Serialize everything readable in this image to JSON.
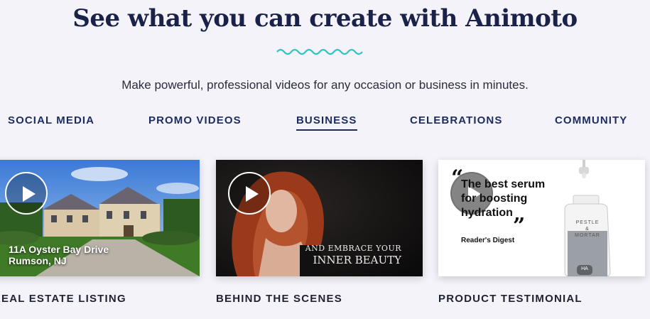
{
  "header": {
    "title": "See what you can create with Animoto",
    "subtitle": "Make powerful, professional videos for any occasion or business in minutes.",
    "accent_color": "#2ec4c4"
  },
  "tabs": [
    {
      "label": "SOCIAL MEDIA",
      "active": false
    },
    {
      "label": "PROMO VIDEOS",
      "active": false
    },
    {
      "label": "BUSINESS",
      "active": true
    },
    {
      "label": "CELEBRATIONS",
      "active": false
    },
    {
      "label": "COMMUNITY",
      "active": false
    }
  ],
  "cards": [
    {
      "label": "REAL ESTATE LISTING",
      "overlay_line1": "11A Oyster Bay Drive",
      "overlay_line2": "Rumson, NJ",
      "icon": "play-icon"
    },
    {
      "label": "BEHIND THE SCENES",
      "overlay_line1": "AND EMBRACE YOUR",
      "overlay_line2": "INNER BEAUTY",
      "icon": "play-icon"
    },
    {
      "label": "PRODUCT TESTIMONIAL",
      "quote_open": "“",
      "quote": "The best serum for boosting hydration",
      "quote_close": "”",
      "source": "Reader's Digest",
      "brand_line1": "PESTLE",
      "brand_amp": "&",
      "brand_line2": "MORTAR",
      "brand_mark": "HA",
      "icon": "play-icon"
    }
  ]
}
